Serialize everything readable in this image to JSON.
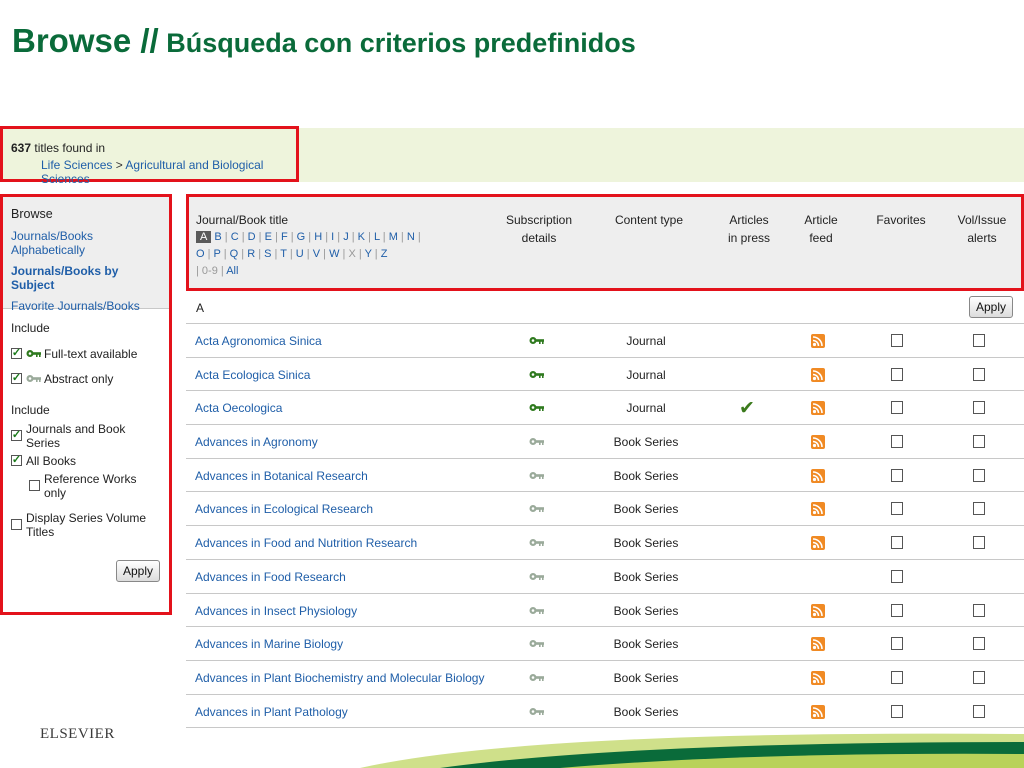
{
  "slide": {
    "title_main": "Browse //",
    "title_sub": " Búsqueda con criterios predefinidos"
  },
  "results": {
    "count": "637",
    "found_text": " titles found in",
    "crumb1": "Life Sciences",
    "crumb_sep": " > ",
    "crumb2": "Agricultural and Biological Sciences"
  },
  "sidebar": {
    "browse_heading": "Browse",
    "links": [
      {
        "label": "Journals/Books Alphabetically"
      },
      {
        "label": "Journals/Books by Subject"
      },
      {
        "label": "Favorite Journals/Books"
      }
    ],
    "include1_label": "Include",
    "include1": [
      {
        "label": "Full-text available",
        "checked": true
      },
      {
        "label": "Abstract only",
        "checked": true
      }
    ],
    "include2_label": "Include",
    "include2": [
      {
        "label": "Journals and Book Series",
        "checked": true
      },
      {
        "label": "All Books",
        "checked": true
      },
      {
        "label": "Reference Works only",
        "checked": false
      }
    ],
    "display_series": {
      "label": "Display Series Volume Titles",
      "checked": false
    },
    "apply_label": "Apply"
  },
  "table": {
    "headers": {
      "title": "Journal/Book title",
      "subscription": [
        "Subscription",
        "details"
      ],
      "content_type": "Content type",
      "articles_in_press": [
        "Articles",
        "in press"
      ],
      "article_feed": [
        "Article",
        "feed"
      ],
      "favorites": "Favorites",
      "alerts": [
        "Vol/Issue",
        "alerts"
      ]
    },
    "alphabet": {
      "current": "A",
      "line1": [
        "B",
        "C",
        "D",
        "E",
        "F",
        "G",
        "H",
        "I",
        "J",
        "K",
        "L",
        "M",
        "N"
      ],
      "line2": [
        "O",
        "P",
        "Q",
        "R",
        "S",
        "T",
        "U",
        "V",
        "W"
      ],
      "disabled_x": "X",
      "line2_tail": [
        "Y",
        "Z"
      ],
      "disabled_09": "0-9",
      "all": "All"
    },
    "section_letter": "A",
    "apply_label": "Apply",
    "rows": [
      {
        "title": "Acta Agronomica Sinica",
        "access": "full-text",
        "type": "Journal",
        "in_press": false,
        "feed": true,
        "alert": true
      },
      {
        "title": "Acta Ecologica Sinica",
        "access": "full-text",
        "type": "Journal",
        "in_press": false,
        "feed": true,
        "alert": true
      },
      {
        "title": "Acta Oecologica",
        "access": "full-text",
        "type": "Journal",
        "in_press": true,
        "feed": true,
        "alert": true
      },
      {
        "title": "Advances in Agronomy",
        "access": "abstract",
        "type": "Book Series",
        "in_press": false,
        "feed": true,
        "alert": true
      },
      {
        "title": "Advances in Botanical Research",
        "access": "abstract",
        "type": "Book Series",
        "in_press": false,
        "feed": true,
        "alert": true
      },
      {
        "title": "Advances in Ecological Research",
        "access": "abstract",
        "type": "Book Series",
        "in_press": false,
        "feed": true,
        "alert": true
      },
      {
        "title": "Advances in Food and Nutrition Research",
        "access": "abstract",
        "type": "Book Series",
        "in_press": false,
        "feed": true,
        "alert": true
      },
      {
        "title": "Advances in Food Research",
        "access": "abstract",
        "type": "Book Series",
        "in_press": false,
        "feed": false,
        "alert": false
      },
      {
        "title": "Advances in Insect Physiology",
        "access": "abstract",
        "type": "Book Series",
        "in_press": false,
        "feed": true,
        "alert": true
      },
      {
        "title": "Advances in Marine Biology",
        "access": "abstract",
        "type": "Book Series",
        "in_press": false,
        "feed": true,
        "alert": true
      },
      {
        "title": "Advances in Plant Biochemistry and Molecular Biology",
        "access": "abstract",
        "type": "Book Series",
        "in_press": false,
        "feed": true,
        "alert": true
      },
      {
        "title": "Advances in Plant Pathology",
        "access": "abstract",
        "type": "Book Series",
        "in_press": false,
        "feed": true,
        "alert": true
      }
    ]
  },
  "footer": {
    "logo": "ELSEVIER"
  },
  "colors": {
    "brand_green": "#0a6b3a",
    "highlight_red": "#e3121b",
    "link_blue": "#1f5ea8",
    "rss_orange": "#f08a24",
    "key_full": "#2f7a1f",
    "key_abstract": "#9aaa9a"
  }
}
